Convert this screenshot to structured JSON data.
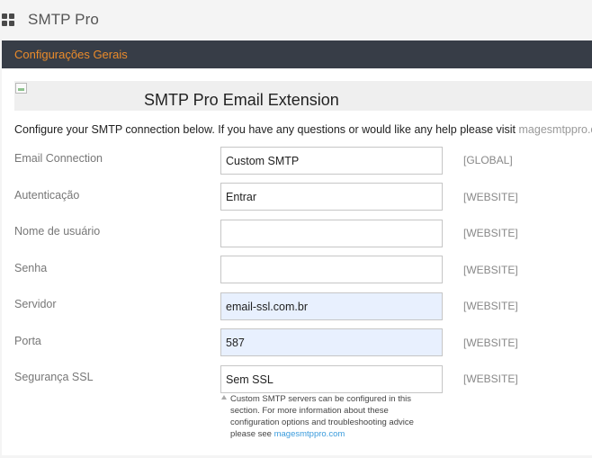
{
  "header": {
    "title": "SMTP Pro"
  },
  "section": {
    "title": "Configurações Gerais"
  },
  "banner": {
    "title": "SMTP Pro Email Extension"
  },
  "intro": {
    "text": "Configure your SMTP connection below. If you have any questions or would like any help please visit",
    "link": "magesmtppro.com"
  },
  "fields": [
    {
      "label": "Email Connection",
      "value": "Custom SMTP",
      "scope": "[GLOBAL]"
    },
    {
      "label": "Autenticação",
      "value": "Entrar",
      "scope": "[WEBSITE]"
    },
    {
      "label": "Nome de usuário",
      "value": "",
      "scope": "[WEBSITE]"
    },
    {
      "label": "Senha",
      "value": "",
      "scope": "[WEBSITE]"
    },
    {
      "label": "Servidor",
      "value": "email-ssl.com.br",
      "scope": "[WEBSITE]"
    },
    {
      "label": "Porta",
      "value": "587",
      "scope": "[WEBSITE]"
    },
    {
      "label": "Segurança SSL",
      "value": "Sem SSL",
      "scope": "[WEBSITE]"
    }
  ],
  "note": {
    "text": "Custom SMTP servers can be configured in this section. For more information about these configuration options and troubleshooting advice please see",
    "link": "magesmtppro.com"
  },
  "colors": {
    "section_bg": "#373d47",
    "section_text": "#eb8b2a",
    "link": "#3a9bdc",
    "autofill_bg": "#e8f0fe"
  }
}
